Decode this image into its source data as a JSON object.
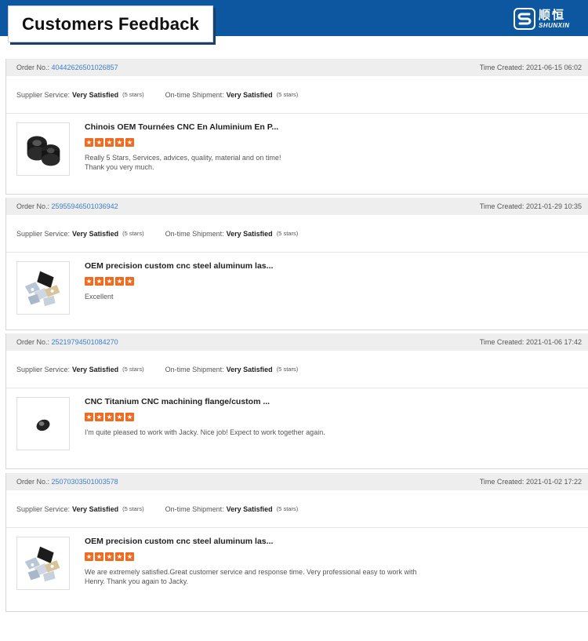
{
  "header": {
    "title": "Customers Feedback",
    "logo_cn": "顺恒",
    "logo_en": "SHUNXIN",
    "bar_color": "#0d57a0"
  },
  "labels": {
    "order_no": "Order No.:",
    "time_created": "Time Created:",
    "supplier_service": "Supplier Service:",
    "ontime_shipment": "On-time Shipment:"
  },
  "accent_colors": {
    "link": "#3a7fc7",
    "star": "#f06a1f"
  },
  "orders": [
    {
      "order_no": "40442626501026857",
      "time": "2021-06-15 06:02",
      "supplier_rating": "Very Satisfied",
      "supplier_stars": "(5 stars)",
      "shipment_rating": "Very Satisfied",
      "shipment_stars": "(5 stars)",
      "product_title": "Chinois OEM Tournées CNC En Aluminium En P...",
      "stars": 5,
      "comment_lines": [
        "Really 5 Stars, Services, advices, quality, material and on time!",
        "Thank you very much."
      ],
      "thumb_icon": "black-bushings-icon"
    },
    {
      "order_no": "25955946501036942",
      "time": "2021-01-29 10:35",
      "supplier_rating": "Very Satisfied",
      "supplier_stars": "(5 stars)",
      "shipment_rating": "Very Satisfied",
      "shipment_stars": "(5 stars)",
      "product_title": "OEM precision custom cnc steel aluminum las...",
      "stars": 5,
      "comment_lines": [
        "Excellent"
      ],
      "thumb_icon": "metal-brackets-icon"
    },
    {
      "order_no": "25219794501084270",
      "time": "2021-01-06 17:42",
      "supplier_rating": "Very Satisfied",
      "supplier_stars": "(5 stars)",
      "shipment_rating": "Very Satisfied",
      "shipment_stars": "(5 stars)",
      "product_title": "CNC Titanium CNC machining flange/custom ...",
      "stars": 5,
      "comment_lines": [
        "I'm quite pleased to work with Jacky. Nice job! Expect to work together  again."
      ],
      "thumb_icon": "titanium-flange-icon"
    },
    {
      "order_no": "25070303501003578",
      "time": "2021-01-02 17:22",
      "supplier_rating": "Very Satisfied",
      "supplier_stars": "(5 stars)",
      "shipment_rating": "Very Satisfied",
      "shipment_stars": "(5 stars)",
      "product_title": "OEM precision custom cnc steel aluminum las...",
      "stars": 5,
      "comment_lines": [
        "We are extremely satisfied.Great customer service and response time. Very professional easy to work with",
        "Henry. Thank you again to Jacky."
      ],
      "thumb_icon": "metal-brackets-icon"
    }
  ]
}
